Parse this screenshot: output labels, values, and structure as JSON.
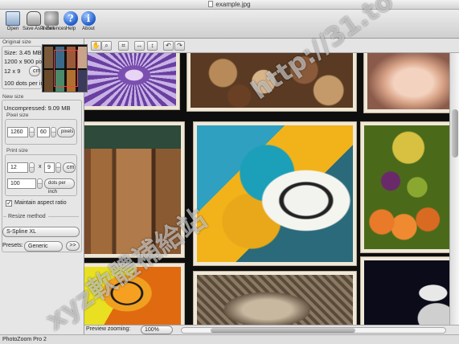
{
  "window": {
    "title": "example.jpg"
  },
  "toolbar": {
    "open_label": "Open",
    "save_label": "Save As & Exit",
    "prefs_label": "Preferences",
    "help_label": "Help",
    "about_label": "About"
  },
  "original": {
    "group_label": "Original size",
    "size_text": "Size: 3.45 MB",
    "pixels_text": "1200 x 900 pixels",
    "print_text": "12 x 9",
    "print_unit": "cm",
    "resolution_text": "100 dots per inch"
  },
  "new_size": {
    "group_label": "New size",
    "uncompressed": "Uncompressed: 9.09 MB",
    "pixel_label": "Pixel size",
    "width_px": "1260",
    "height_px": "60",
    "px_unit": "pixels",
    "print_label": "Print size",
    "width_print": "12",
    "height_print": "9",
    "print_unit": "cm",
    "resolution": "100",
    "res_unit": "dots per inch",
    "maintain_aspect": "Maintain aspect ratio"
  },
  "resize": {
    "group_label": "Resize method",
    "method": "S-Spline XL",
    "presets_label": "Presets:",
    "preset_value": "Generic",
    "preset_go": ">>"
  },
  "view": {
    "zoom_label": "Preview zooming:",
    "zoom_value": "100%"
  },
  "footer": {
    "app_name": "PhotoZoom Pro 2"
  },
  "watermarks": {
    "url": "http://31.to",
    "chinese": "xyz軟體補給站"
  },
  "colors": {
    "frame": "#efe8d8",
    "canvas_bg": "#0e0e0e",
    "accent_blue": "#1e5cc8"
  }
}
